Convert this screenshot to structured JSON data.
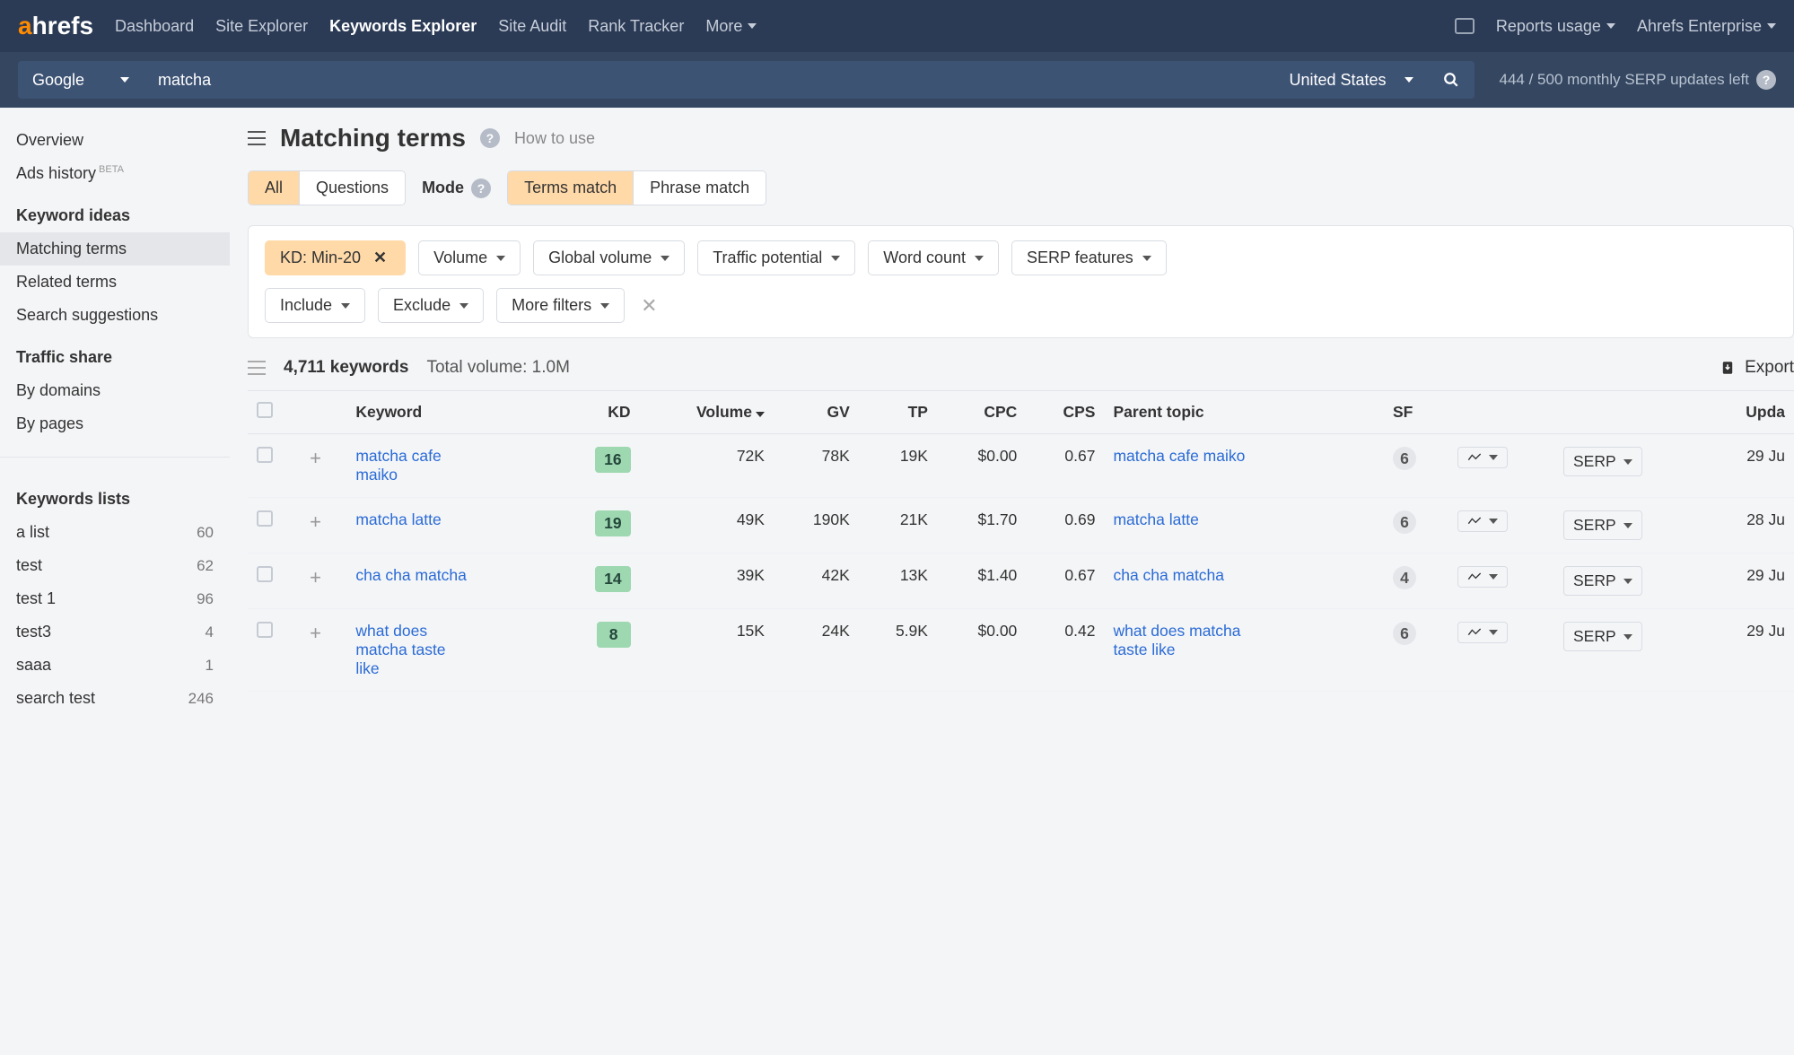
{
  "nav": {
    "logo_a": "a",
    "logo_rest": "hrefs",
    "items": [
      "Dashboard",
      "Site Explorer",
      "Keywords Explorer",
      "Site Audit",
      "Rank Tracker",
      "More"
    ],
    "active_index": 2,
    "reports": "Reports usage",
    "account": "Ahrefs Enterprise"
  },
  "search": {
    "engine": "Google",
    "query": "matcha",
    "country": "United States",
    "updates": "444 / 500 monthly SERP updates left"
  },
  "sidebar": {
    "overview": "Overview",
    "ads_history": "Ads history",
    "ads_history_badge": "BETA",
    "section_ideas": "Keyword ideas",
    "ideas": [
      "Matching terms",
      "Related terms",
      "Search suggestions"
    ],
    "ideas_active": 0,
    "section_traffic": "Traffic share",
    "traffic": [
      "By domains",
      "By pages"
    ],
    "section_lists": "Keywords lists",
    "lists": [
      {
        "name": "a list",
        "count": "60"
      },
      {
        "name": "test",
        "count": "62"
      },
      {
        "name": "test 1",
        "count": "96"
      },
      {
        "name": "test3",
        "count": "4"
      },
      {
        "name": "saaa",
        "count": "1"
      },
      {
        "name": "search test",
        "count": "246"
      }
    ]
  },
  "page": {
    "title": "Matching terms",
    "how_to": "How to use",
    "seg1": [
      "All",
      "Questions"
    ],
    "seg1_active": 0,
    "mode_label": "Mode",
    "seg2": [
      "Terms match",
      "Phrase match"
    ],
    "seg2_active": 0
  },
  "filters": {
    "active": {
      "label": "KD: Min-20"
    },
    "row1": [
      "Volume",
      "Global volume",
      "Traffic potential",
      "Word count",
      "SERP features"
    ],
    "row2": [
      "Include",
      "Exclude",
      "More filters"
    ]
  },
  "results": {
    "count_label": "4,711 keywords",
    "total_vol": "Total volume: 1.0M",
    "export": "Export",
    "columns": [
      "",
      "",
      "Keyword",
      "KD",
      "Volume",
      "GV",
      "TP",
      "CPC",
      "CPS",
      "Parent topic",
      "SF",
      "",
      "",
      "Upda"
    ],
    "sort_col": 4,
    "serp_btn": "SERP",
    "rows": [
      {
        "kw": "matcha cafe maiko",
        "kd": "16",
        "vol": "72K",
        "gv": "78K",
        "tp": "19K",
        "cpc": "$0.00",
        "cps": "0.67",
        "parent": "matcha cafe maiko",
        "sf": "6",
        "upd": "29 Ju"
      },
      {
        "kw": "matcha latte",
        "kd": "19",
        "vol": "49K",
        "gv": "190K",
        "tp": "21K",
        "cpc": "$1.70",
        "cps": "0.69",
        "parent": "matcha latte",
        "sf": "6",
        "upd": "28 Ju"
      },
      {
        "kw": "cha cha matcha",
        "kd": "14",
        "vol": "39K",
        "gv": "42K",
        "tp": "13K",
        "cpc": "$1.40",
        "cps": "0.67",
        "parent": "cha cha matcha",
        "sf": "4",
        "upd": "29 Ju"
      },
      {
        "kw": "what does matcha taste like",
        "kd": "8",
        "vol": "15K",
        "gv": "24K",
        "tp": "5.9K",
        "cpc": "$0.00",
        "cps": "0.42",
        "parent": "what does matcha taste like",
        "sf": "6",
        "upd": "29 Ju"
      }
    ]
  }
}
